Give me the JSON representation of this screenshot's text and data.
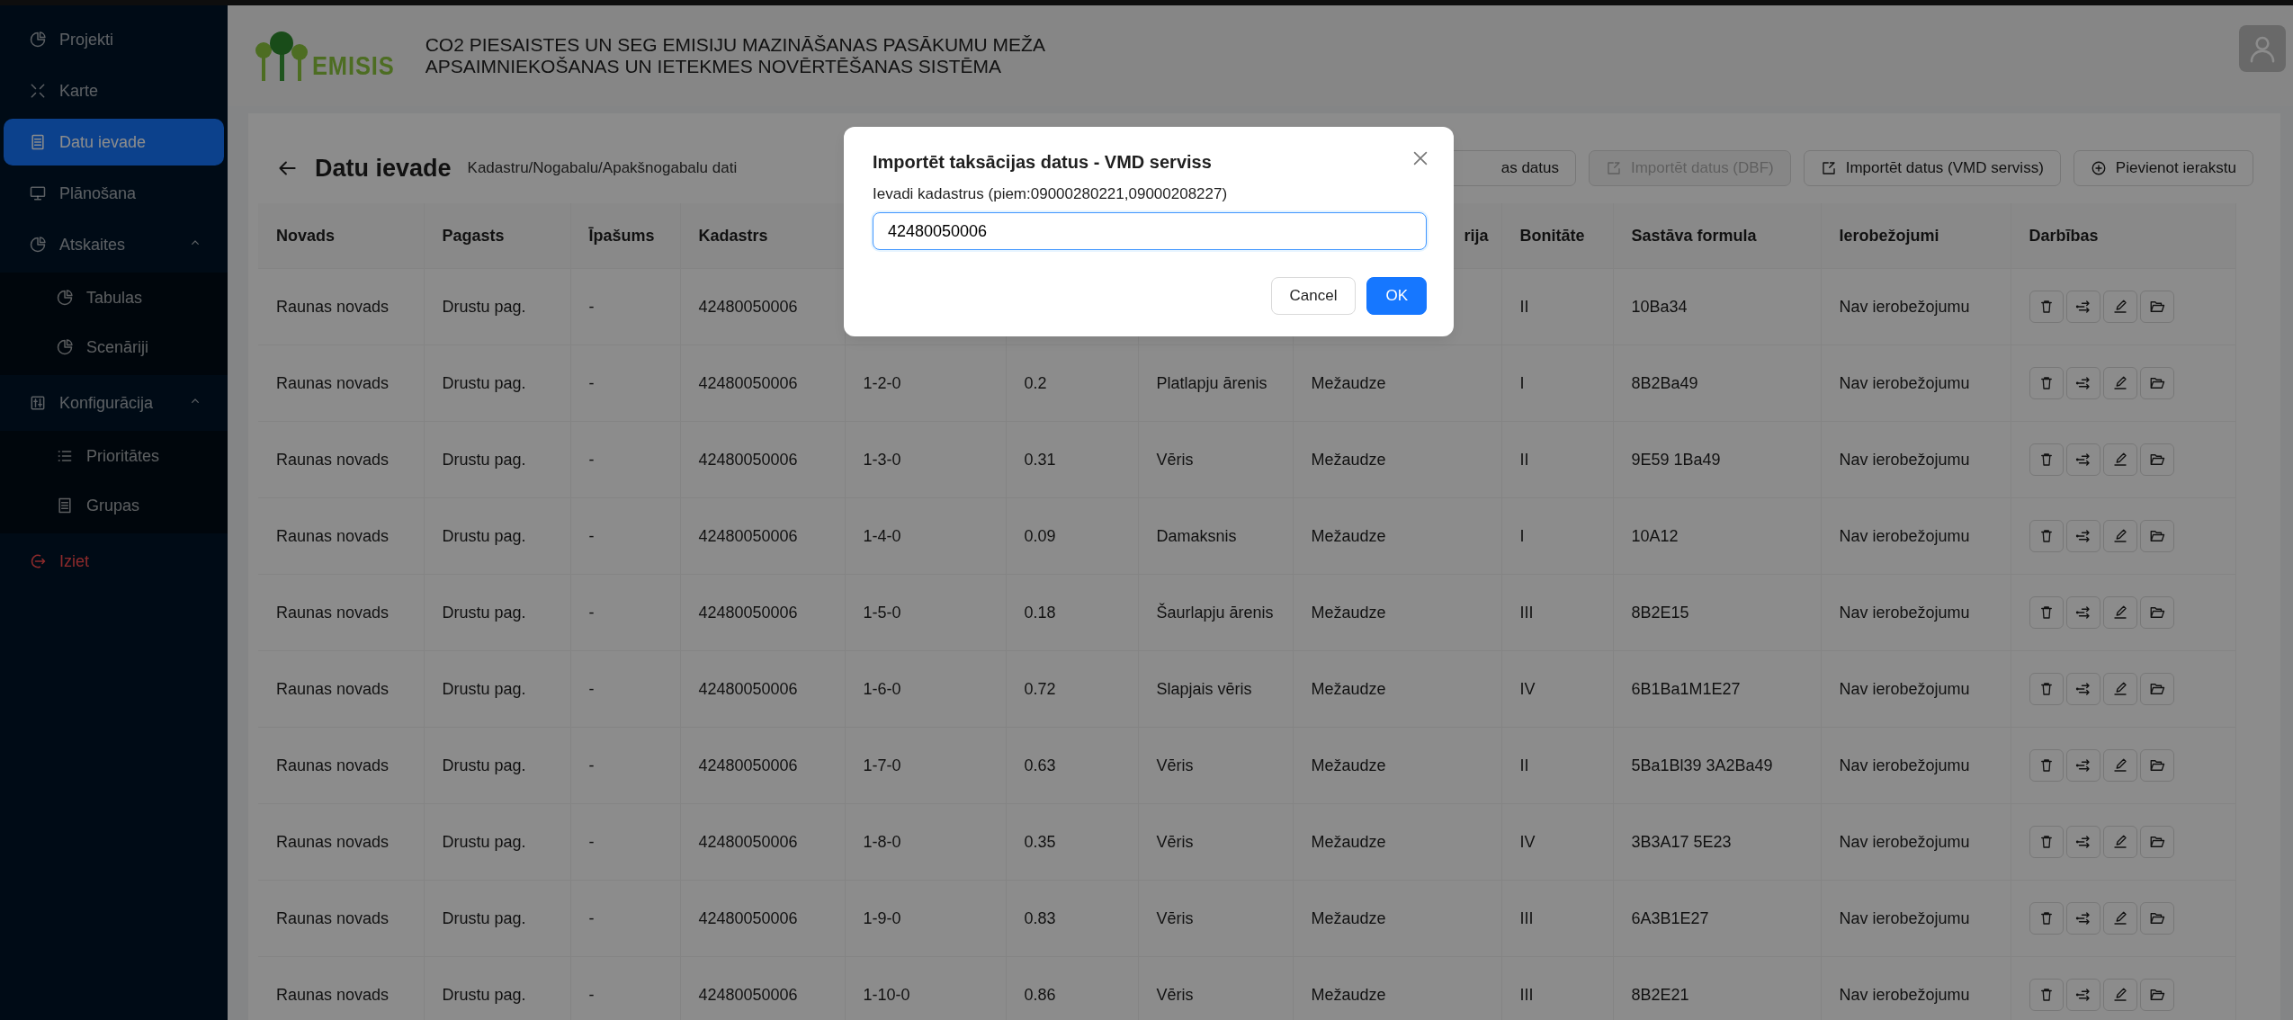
{
  "sidebar": {
    "items": [
      {
        "label": "Projekti",
        "kind": "link",
        "selected": false
      },
      {
        "label": "Karte",
        "kind": "link",
        "selected": false
      },
      {
        "label": "Datu ievade",
        "kind": "link",
        "selected": true
      },
      {
        "label": "Plānošana",
        "kind": "link",
        "selected": false
      },
      {
        "label": "Atskaites",
        "kind": "group",
        "selected": false,
        "expanded": true,
        "children": [
          {
            "label": "Tabulas",
            "selected": false
          },
          {
            "label": "Scenāriji",
            "selected": false
          }
        ]
      },
      {
        "label": "Konfigurācija",
        "kind": "group",
        "selected": false,
        "expanded": true,
        "children": [
          {
            "label": "Prioritātes",
            "selected": false
          },
          {
            "label": "Grupas",
            "selected": false
          }
        ]
      },
      {
        "label": "Iziet",
        "kind": "logout",
        "selected": false
      }
    ]
  },
  "header": {
    "logo_text": "EMISIS",
    "title_lines": [
      "CO2 PIESAISTES UN SEG EMISIJU MAZINĀŠANAS PASĀKUMU MEŽA",
      "APSAIMNIEKOŠANAS UN IETEKMES NOVĒRTĒŠANAS SISTĒMA"
    ]
  },
  "page": {
    "title": "Datu ievade",
    "subtitle": "Kadastru/Nogabalu/Apakšnogabalu dati",
    "toolbar": [
      {
        "label": "as datus",
        "kind": "plain",
        "disabled": false,
        "cut": true
      },
      {
        "label": "Importēt datus (DBF)",
        "kind": "import",
        "disabled": true,
        "cut": false
      },
      {
        "label": "Importēt datus (VMD serviss)",
        "kind": "import",
        "disabled": false,
        "cut": false
      },
      {
        "label": "Pievienot ierakstu",
        "kind": "add",
        "disabled": false,
        "cut": false
      }
    ]
  },
  "table": {
    "columns": [
      {
        "label": "Novads"
      },
      {
        "label": "Pagasts"
      },
      {
        "label": "Īpašums"
      },
      {
        "label": "Kadastrs"
      },
      {},
      {},
      {},
      {
        "label": "rija"
      },
      {
        "label": "Bonitāte"
      },
      {
        "label": "Sastāva formula"
      },
      {
        "label": "Ierobežojumi"
      },
      {
        "label": "Darbības"
      }
    ],
    "rows": [
      {
        "cells": [
          "Raunas novads",
          "Drustu pag.",
          "-",
          "42480050006",
          null,
          null,
          null,
          null,
          "II",
          "10Ba34",
          "Nav ierobežojumu"
        ]
      },
      {
        "cells": [
          "Raunas novads",
          "Drustu pag.",
          "-",
          "42480050006",
          "1-2-0",
          "0.2",
          "Platlapju ārenis",
          "Mežaudze",
          "I",
          "8B2Ba49",
          "Nav ierobežojumu"
        ]
      },
      {
        "cells": [
          "Raunas novads",
          "Drustu pag.",
          "-",
          "42480050006",
          "1-3-0",
          "0.31",
          "Vēris",
          "Mežaudze",
          "II",
          "9E59 1Ba49",
          "Nav ierobežojumu"
        ]
      },
      {
        "cells": [
          "Raunas novads",
          "Drustu pag.",
          "-",
          "42480050006",
          "1-4-0",
          "0.09",
          "Damaksnis",
          "Mežaudze",
          "I",
          "10A12",
          "Nav ierobežojumu"
        ]
      },
      {
        "cells": [
          "Raunas novads",
          "Drustu pag.",
          "-",
          "42480050006",
          "1-5-0",
          "0.18",
          "Šaurlapju ārenis",
          "Mežaudze",
          "III",
          "8B2E15",
          "Nav ierobežojumu"
        ]
      },
      {
        "cells": [
          "Raunas novads",
          "Drustu pag.",
          "-",
          "42480050006",
          "1-6-0",
          "0.72",
          "Slapjais vēris",
          "Mežaudze",
          "IV",
          "6B1Ba1M1E27",
          "Nav ierobežojumu"
        ]
      },
      {
        "cells": [
          "Raunas novads",
          "Drustu pag.",
          "-",
          "42480050006",
          "1-7-0",
          "0.63",
          "Vēris",
          "Mežaudze",
          "II",
          "5Ba1Bl39 3A2Ba49",
          "Nav ierobežojumu"
        ]
      },
      {
        "cells": [
          "Raunas novads",
          "Drustu pag.",
          "-",
          "42480050006",
          "1-8-0",
          "0.35",
          "Vēris",
          "Mežaudze",
          "IV",
          "3B3A17 5E23",
          "Nav ierobežojumu"
        ]
      },
      {
        "cells": [
          "Raunas novads",
          "Drustu pag.",
          "-",
          "42480050006",
          "1-9-0",
          "0.83",
          "Vēris",
          "Mežaudze",
          "III",
          "6A3B1E27",
          "Nav ierobežojumu"
        ]
      },
      {
        "cells": [
          "Raunas novads",
          "Drustu pag.",
          "-",
          "42480050006",
          "1-10-0",
          "0.86",
          "Vēris",
          "Mežaudze",
          "III",
          "8B2E21",
          "Nav ierobežojumu"
        ]
      }
    ]
  },
  "modal": {
    "title": "Importēt taksācijas datus - VMD serviss",
    "label": "Ievadi kadastrus (piem:09000280221,09000208227)",
    "value": "42480050006",
    "buttons": [
      {
        "label": "Cancel",
        "kind": "default"
      },
      {
        "label": "OK",
        "kind": "primary"
      }
    ]
  }
}
